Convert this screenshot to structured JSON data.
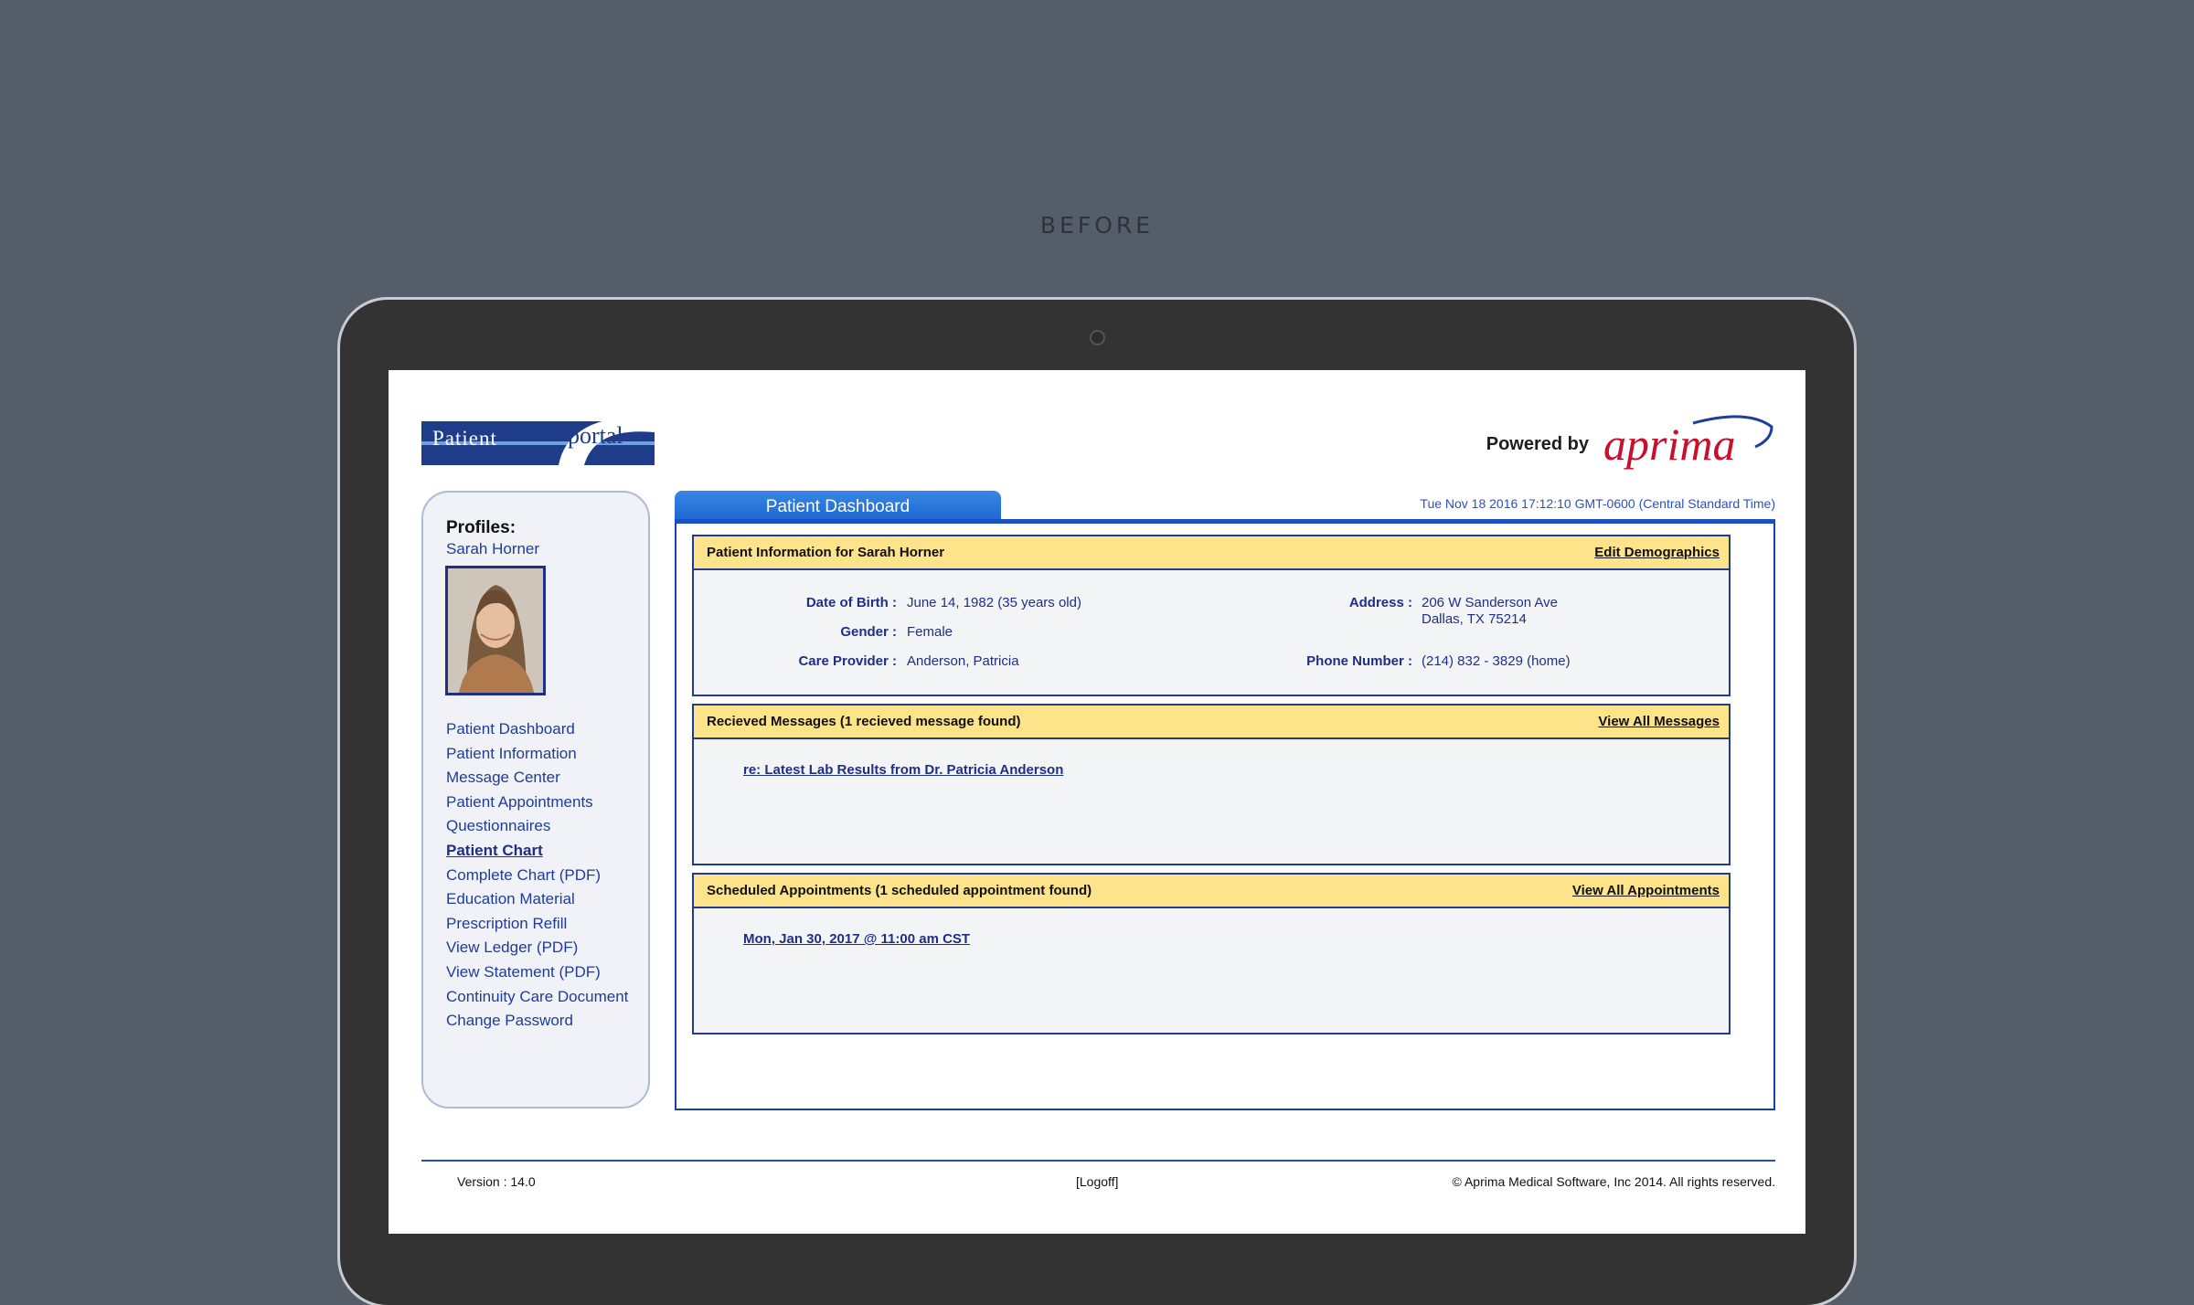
{
  "caption": "BEFORE",
  "header": {
    "logo_word1": "Patient",
    "logo_word2": "portal",
    "powered_label": "Powered by",
    "brand_name": "aprima",
    "timestamp": "Tue Nov 18 2016 17:12:10 GMT-0600 (Central Standard Time)"
  },
  "sidebar": {
    "profiles_title": "Profiles:",
    "profile_name": "Sarah Horner",
    "nav": [
      {
        "label": "Patient Dashboard",
        "active": false
      },
      {
        "label": "Patient Information",
        "active": false
      },
      {
        "label": "Message Center",
        "active": false
      },
      {
        "label": "Patient Appointments",
        "active": false
      },
      {
        "label": "Questionnaires",
        "active": false
      },
      {
        "label": "Patient Chart",
        "active": true
      },
      {
        "label": "Complete Chart (PDF)",
        "active": false
      },
      {
        "label": "Education Material",
        "active": false
      },
      {
        "label": "Prescription Refill",
        "active": false
      },
      {
        "label": "View Ledger (PDF)",
        "active": false
      },
      {
        "label": "View Statement (PDF)",
        "active": false
      },
      {
        "label": "Continuity Care Document",
        "active": false
      },
      {
        "label": "Change Password",
        "active": false
      }
    ]
  },
  "main": {
    "tab_label": "Patient Dashboard",
    "patient_info": {
      "title": "Patient Information for Sarah Horner",
      "action": "Edit Demographics",
      "dob_label": "Date of Birth :",
      "dob_value": "June 14, 1982 (35 years old)",
      "gender_label": "Gender :",
      "gender_value": "Female",
      "provider_label": "Care Provider :",
      "provider_value": "Anderson, Patricia",
      "address_label": "Address :",
      "address_line1": "206 W Sanderson Ave",
      "address_line2": "Dallas, TX 75214",
      "phone_label": "Phone Number :",
      "phone_value": "(214) 832 - 3829 (home)"
    },
    "messages": {
      "title": "Recieved Messages (1 recieved message found)",
      "action": "View All Messages",
      "item": "re: Latest Lab Results from Dr. Patricia Anderson"
    },
    "appointments": {
      "title": "Scheduled Appointments (1 scheduled appointment found)",
      "action": "View All Appointments",
      "item": "Mon, Jan 30, 2017 @ 11:00 am CST"
    }
  },
  "footer": {
    "version": "Version : 14.0",
    "logoff": "[Logoff]",
    "copyright": "© Aprima Medical Software, Inc 2014. All rights reserved."
  },
  "colors": {
    "background": "#555e68",
    "link_blue": "#1f3c9a",
    "tab_blue": "#1a64cf",
    "panel_header": "#fde38a",
    "brand_red": "#c8102e"
  }
}
